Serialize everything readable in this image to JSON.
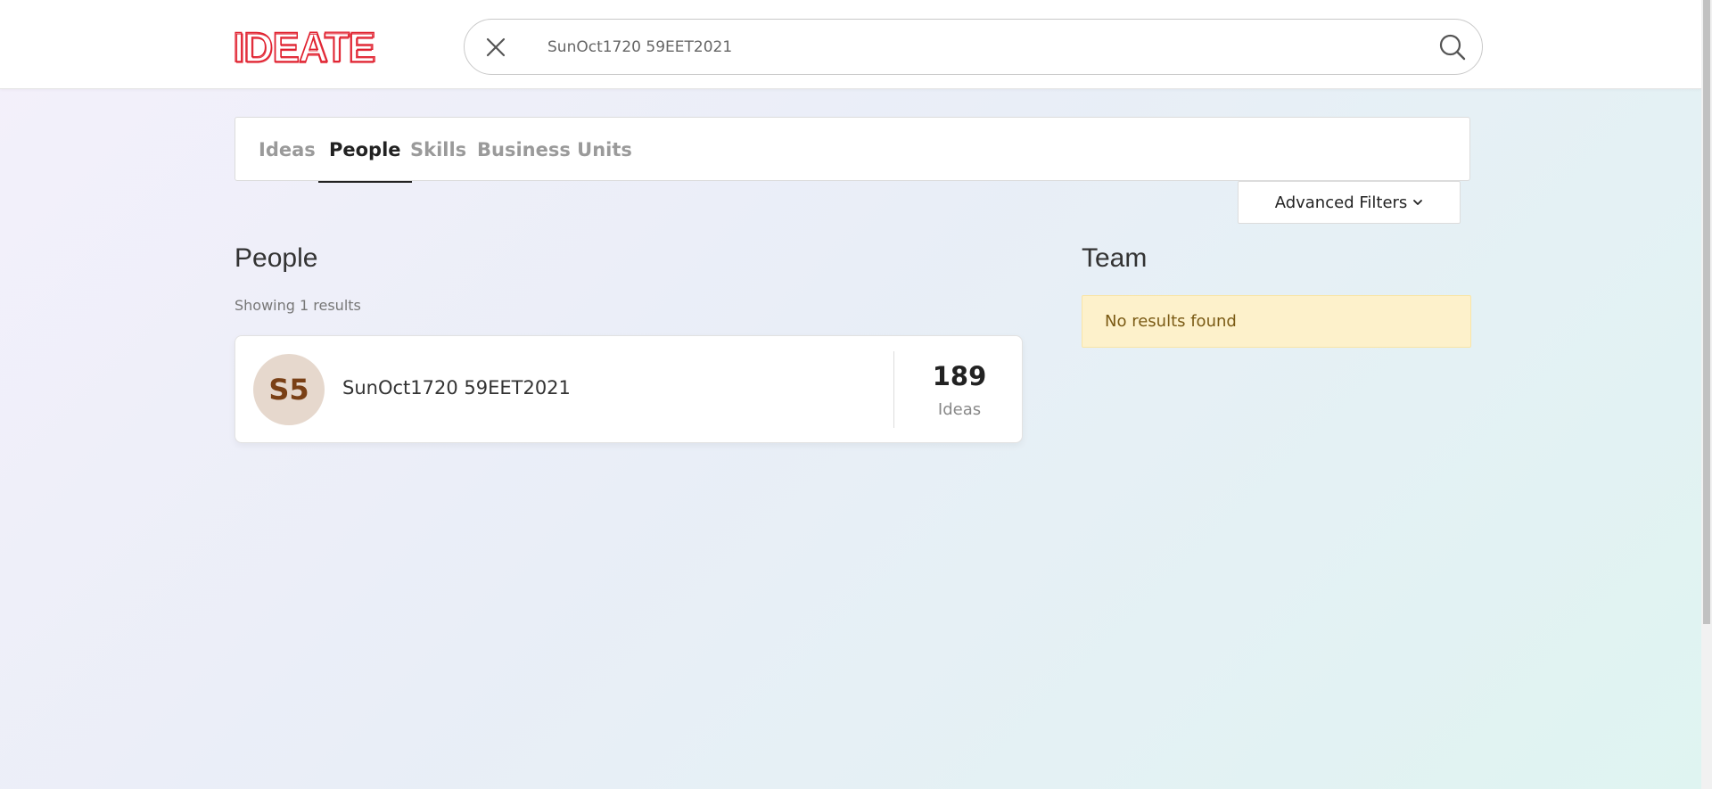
{
  "header": {
    "logo_text": "IDEATE",
    "brand_color": "#e0202e",
    "search": {
      "value": "SunOct1720 59EET2021"
    }
  },
  "tabs": [
    {
      "label": "Ideas",
      "active": false
    },
    {
      "label": "People",
      "active": true
    },
    {
      "label": "Skills",
      "active": false
    },
    {
      "label": "Business Units",
      "active": false
    }
  ],
  "advanced_filters_label": "Advanced Filters",
  "people": {
    "title": "People",
    "showing": "Showing 1 results",
    "results": [
      {
        "initials": "S5",
        "name": "SunOct1720 59EET2021",
        "count": "189",
        "count_label": "Ideas"
      }
    ]
  },
  "team": {
    "title": "Team",
    "empty_message": "No results found"
  }
}
